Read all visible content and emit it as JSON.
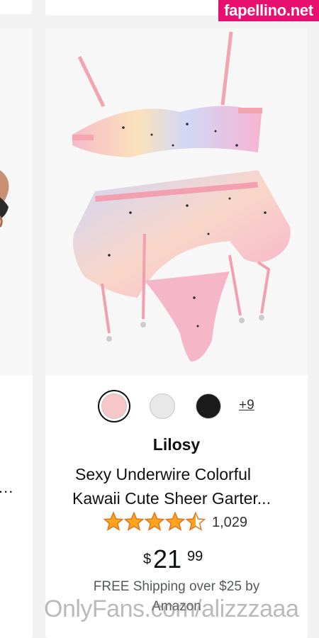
{
  "watermark_top": "fapellino.net",
  "watermark_bottom": "OnlyFans.com/alizzzaaa",
  "left_card": {
    "ellipsis": "..."
  },
  "product": {
    "swatches": [
      {
        "color": "#f7c6c9",
        "selected": true
      },
      {
        "color": "#e8e8e8",
        "selected": false
      },
      {
        "color": "#1a1a1a",
        "selected": false
      }
    ],
    "more_swatches": "+9",
    "brand": "Lilosy",
    "title_line1": "Sexy Underwire Colorful",
    "title_line2": "Kawaii Cute Sheer Garter...",
    "rating_stars": 4.5,
    "rating_count": "1,029",
    "price_symbol": "$",
    "price_whole": "21",
    "price_fraction": "99",
    "shipping_line1": "FREE Shipping over $25 by",
    "shipping_line2": "Amazon"
  },
  "colors": {
    "star": "#ffa41c",
    "star_outline": "#de7921",
    "watermark_bg": "#e8106f"
  }
}
